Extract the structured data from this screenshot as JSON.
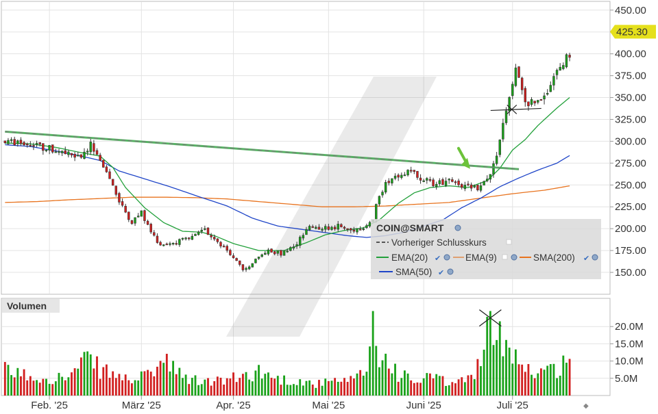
{
  "chart_data": {
    "type": "candlestick",
    "title": "COIN@SMART",
    "price_axis": {
      "ylim": [
        125,
        460
      ],
      "ticks": [
        "450.00",
        "425.00",
        "400.00",
        "375.00",
        "350.00",
        "325.00",
        "300.00",
        "275.00",
        "250.00",
        "225.00",
        "200.00",
        "175.00",
        "150.00"
      ],
      "tick_values": [
        450,
        425,
        400,
        375,
        350,
        325,
        300,
        275,
        250,
        225,
        200,
        175,
        150
      ],
      "last_price_label": "425.30",
      "last_price": 425.3,
      "grid": true
    },
    "volume_axis": {
      "title": "Volumen",
      "ylim": [
        0,
        25
      ],
      "ticks": [
        "20.0M",
        "15.0M",
        "10.0M",
        "5.0M"
      ],
      "tick_values": [
        20,
        15,
        10,
        5
      ],
      "unit": "M"
    },
    "x_axis": {
      "ticks": [
        "Feb. '25",
        "März '25",
        "Apr. '25",
        "Mai '25",
        "Juni '25",
        "Juli '25"
      ],
      "tick_index": [
        14,
        43,
        72,
        102,
        132,
        160
      ],
      "n_sessions": 179
    },
    "legend": {
      "placement": "lower-right",
      "entries": [
        {
          "label": "Vorheriger Schlusskurs",
          "color": "#555555",
          "dashed": true
        },
        {
          "label": "EMA(20)",
          "color": "#22a03a"
        },
        {
          "label": "EMA(9)",
          "color": "#e0a070"
        },
        {
          "label": "SMA(200)",
          "color": "#e8731e"
        },
        {
          "label": "SMA(50)",
          "color": "#1f45c8"
        }
      ]
    },
    "colors": {
      "up": "#1aa21a",
      "down": "#d11f1f",
      "ema20": "#22a03a",
      "sma50": "#1f45c8",
      "sma200": "#e8731e",
      "trendline": "#3aa84a",
      "annotation_arrow": "#6cc23a",
      "last_price_bg": "#e5e01c"
    },
    "price_anchors": [
      [
        0,
        300
      ],
      [
        4,
        298
      ],
      [
        8,
        296
      ],
      [
        12,
        293
      ],
      [
        16,
        290
      ],
      [
        20,
        284
      ],
      [
        24,
        281
      ],
      [
        27,
        296
      ],
      [
        30,
        275
      ],
      [
        33,
        260
      ],
      [
        36,
        230
      ],
      [
        40,
        208
      ],
      [
        43,
        218
      ],
      [
        46,
        196
      ],
      [
        49,
        182
      ],
      [
        53,
        184
      ],
      [
        58,
        188
      ],
      [
        63,
        198
      ],
      [
        67,
        186
      ],
      [
        71,
        172
      ],
      [
        75,
        152
      ],
      [
        79,
        163
      ],
      [
        83,
        176
      ],
      [
        87,
        171
      ],
      [
        92,
        183
      ],
      [
        96,
        203
      ],
      [
        101,
        201
      ],
      [
        105,
        203
      ],
      [
        109,
        198
      ],
      [
        113,
        203
      ],
      [
        116,
        210
      ],
      [
        118,
        240
      ],
      [
        121,
        256
      ],
      [
        125,
        265
      ],
      [
        129,
        263
      ],
      [
        133,
        255
      ],
      [
        136,
        250
      ],
      [
        140,
        258
      ],
      [
        144,
        250
      ],
      [
        147,
        245
      ],
      [
        150,
        248
      ],
      [
        153,
        263
      ],
      [
        155,
        282
      ],
      [
        157,
        318
      ],
      [
        159,
        350
      ],
      [
        161,
        380
      ],
      [
        163,
        360
      ],
      [
        165,
        338
      ],
      [
        167,
        348
      ],
      [
        169,
        350
      ],
      [
        172,
        365
      ],
      [
        175,
        385
      ],
      [
        178,
        400
      ],
      [
        180,
        395
      ],
      [
        182,
        415
      ],
      [
        183,
        425
      ]
    ],
    "volume_anchors": [
      [
        0,
        7.5
      ],
      [
        10,
        5.5
      ],
      [
        20,
        5.5
      ],
      [
        26,
        11
      ],
      [
        30,
        8
      ],
      [
        38,
        5
      ],
      [
        44,
        5.5
      ],
      [
        50,
        10.5
      ],
      [
        56,
        5.5
      ],
      [
        62,
        4.2
      ],
      [
        68,
        4.5
      ],
      [
        74,
        5.5
      ],
      [
        80,
        7.5
      ],
      [
        86,
        5
      ],
      [
        92,
        4.5
      ],
      [
        98,
        3.5
      ],
      [
        104,
        4.2
      ],
      [
        110,
        4.5
      ],
      [
        114,
        8
      ],
      [
        116,
        24.5
      ],
      [
        118,
        10.5
      ],
      [
        121,
        11
      ],
      [
        124,
        6.5
      ],
      [
        130,
        4
      ],
      [
        134,
        6
      ],
      [
        140,
        3.5
      ],
      [
        146,
        5
      ],
      [
        151,
        12
      ],
      [
        153,
        24
      ],
      [
        155,
        17
      ],
      [
        158,
        18
      ],
      [
        162,
        11
      ],
      [
        166,
        7
      ],
      [
        170,
        8
      ],
      [
        173,
        7.5
      ],
      [
        176,
        10
      ],
      [
        179,
        9.5
      ],
      [
        181,
        10
      ],
      [
        183,
        17.5
      ]
    ],
    "ema20_anchors": [
      [
        0,
        298
      ],
      [
        8,
        297
      ],
      [
        16,
        293
      ],
      [
        24,
        287
      ],
      [
        30,
        283
      ],
      [
        34,
        270
      ],
      [
        38,
        247
      ],
      [
        44,
        224
      ],
      [
        50,
        207
      ],
      [
        56,
        197
      ],
      [
        62,
        196
      ],
      [
        66,
        192
      ],
      [
        72,
        183
      ],
      [
        80,
        175
      ],
      [
        88,
        175
      ],
      [
        95,
        184
      ],
      [
        101,
        193
      ],
      [
        107,
        198
      ],
      [
        113,
        201
      ],
      [
        118,
        210
      ],
      [
        124,
        229
      ],
      [
        129,
        241
      ],
      [
        134,
        247
      ],
      [
        140,
        249
      ],
      [
        146,
        247
      ],
      [
        152,
        255
      ],
      [
        156,
        269
      ],
      [
        160,
        290
      ],
      [
        164,
        302
      ],
      [
        168,
        318
      ],
      [
        174,
        338
      ],
      [
        178,
        350
      ],
      [
        183,
        362
      ]
    ],
    "sma50_anchors": [
      [
        0,
        296
      ],
      [
        8,
        294
      ],
      [
        16,
        289
      ],
      [
        24,
        283
      ],
      [
        30,
        278
      ],
      [
        36,
        266
      ],
      [
        44,
        257
      ],
      [
        52,
        248
      ],
      [
        60,
        238
      ],
      [
        70,
        226
      ],
      [
        78,
        212
      ],
      [
        86,
        203
      ],
      [
        94,
        199
      ],
      [
        100,
        196
      ],
      [
        108,
        192
      ],
      [
        114,
        190
      ],
      [
        120,
        192
      ],
      [
        126,
        196
      ],
      [
        132,
        203
      ],
      [
        138,
        210
      ],
      [
        144,
        224
      ],
      [
        150,
        235
      ],
      [
        156,
        248
      ],
      [
        162,
        258
      ],
      [
        168,
        267
      ],
      [
        174,
        275
      ],
      [
        180,
        288
      ],
      [
        183,
        296
      ]
    ],
    "sma200_anchors": [
      [
        0,
        230
      ],
      [
        10,
        231
      ],
      [
        20,
        233
      ],
      [
        30,
        234.5
      ],
      [
        40,
        236
      ],
      [
        50,
        236
      ],
      [
        60,
        235.5
      ],
      [
        70,
        234
      ],
      [
        80,
        231
      ],
      [
        90,
        228
      ],
      [
        100,
        225
      ],
      [
        110,
        225
      ],
      [
        120,
        226
      ],
      [
        130,
        228
      ],
      [
        140,
        230
      ],
      [
        150,
        235
      ],
      [
        160,
        240
      ],
      [
        170,
        244
      ],
      [
        178,
        249
      ],
      [
        183,
        252
      ]
    ],
    "trendline": {
      "from": [
        0,
        311
      ],
      "to": [
        162,
        268
      ]
    }
  }
}
